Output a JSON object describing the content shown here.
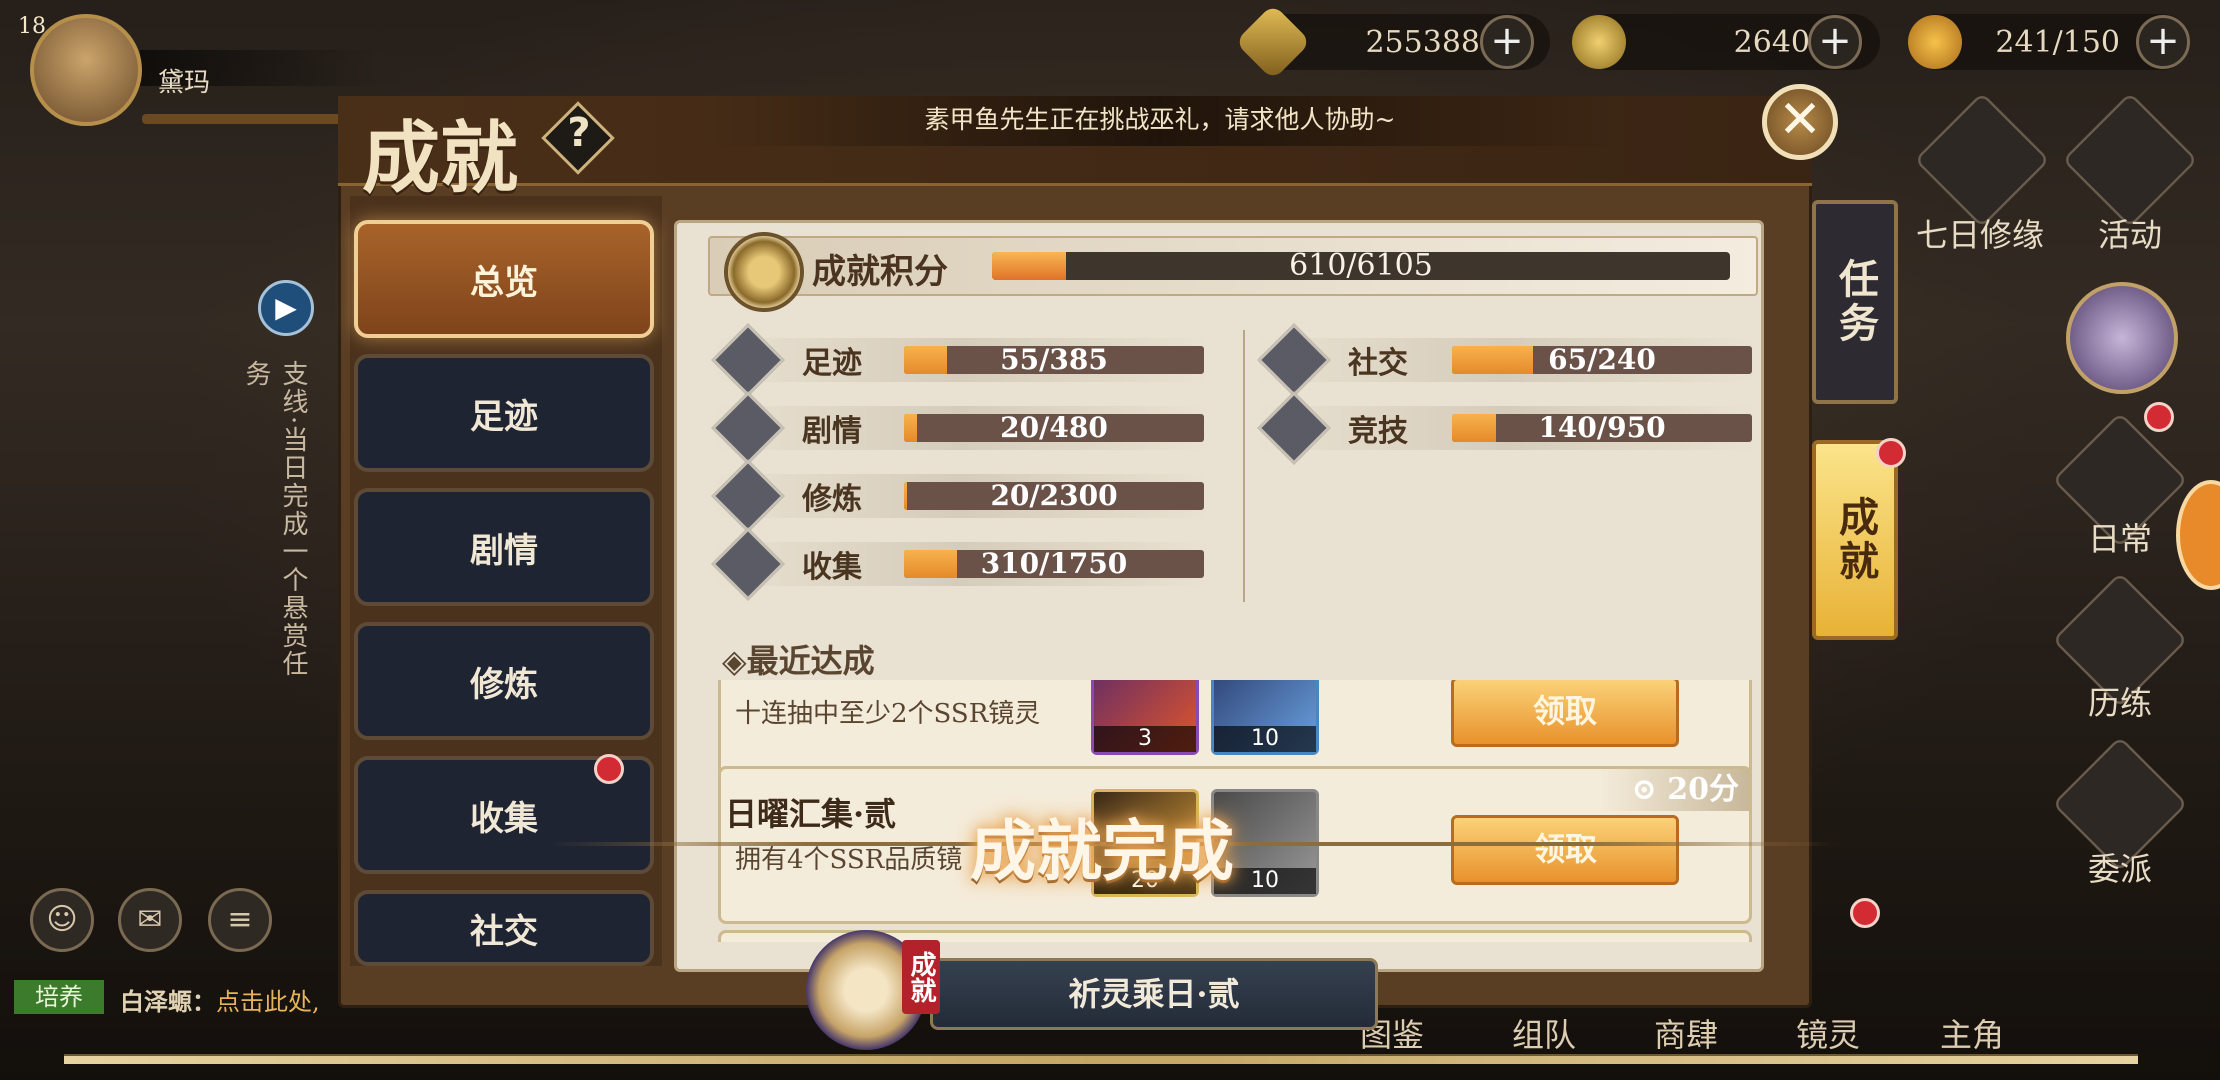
{
  "player": {
    "level": "18",
    "name": "黛玛"
  },
  "resources": [
    {
      "icon": "coin-icon",
      "value": "255388"
    },
    {
      "icon": "gear-currency-icon",
      "value": "2640"
    },
    {
      "icon": "stamina-icon",
      "value": "241/150"
    }
  ],
  "header": {
    "title": "成就",
    "help": "?",
    "notice": "素甲鱼先生正在挑战巫礼，请求他人协助~",
    "close": "✕"
  },
  "nav": [
    {
      "label": "总览",
      "active": true
    },
    {
      "label": "足迹"
    },
    {
      "label": "剧情"
    },
    {
      "label": "修炼"
    },
    {
      "label": "收集",
      "badge": true
    },
    {
      "label": "社交"
    }
  ],
  "overview": {
    "title": "成就积分",
    "score": "610/6105",
    "score_fraction": 0.0999,
    "categories_left": [
      {
        "label": "足迹",
        "value": "55/385",
        "fraction": 0.143,
        "icon": "footprint-icon"
      },
      {
        "label": "剧情",
        "value": "20/480",
        "fraction": 0.042,
        "icon": "film-icon"
      },
      {
        "label": "修炼",
        "value": "20/2300",
        "fraction": 0.009,
        "icon": "train-icon"
      },
      {
        "label": "收集",
        "value": "310/1750",
        "fraction": 0.177,
        "icon": "collection-icon"
      }
    ],
    "categories_right": [
      {
        "label": "社交",
        "value": "65/240",
        "fraction": 0.271,
        "icon": "chat-icon"
      },
      {
        "label": "竞技",
        "value": "140/950",
        "fraction": 0.147,
        "icon": "sword-icon"
      }
    ]
  },
  "recent": {
    "title": "◈最近达成",
    "cards": [
      {
        "name": "",
        "desc": "十连抽中至少2个SSR镜灵",
        "items": [
          "3",
          "10"
        ],
        "claim": "领取",
        "points": ""
      },
      {
        "name": "日曜汇集·贰",
        "desc": "拥有4个SSR品质镜",
        "items": [
          "20",
          "10"
        ],
        "claim": "领取",
        "points": "20分"
      }
    ]
  },
  "toast": "成就完成",
  "side_tabs": [
    {
      "label": "任务"
    },
    {
      "label": "成就",
      "active": true
    }
  ],
  "bottom_tab": {
    "stamp": "成就",
    "label": "祈灵乘日·贰"
  },
  "right_menu": [
    {
      "label": "七日修缘"
    },
    {
      "label": "活动"
    },
    {
      "label": "日常"
    },
    {
      "label": "历练"
    },
    {
      "label": "委派"
    }
  ],
  "bottom_nav": [
    "图鉴",
    "组队",
    "商肆",
    "镜灵",
    "主角"
  ],
  "side_quest": "支线·当日完成一个悬赏任务",
  "chat": {
    "channel": "培养",
    "speaker": "白泽螈：",
    "message": "点击此处,"
  },
  "colors": {
    "accent": "#e0722a",
    "active_tab": "#a8632a",
    "badge": "#d22b33"
  }
}
